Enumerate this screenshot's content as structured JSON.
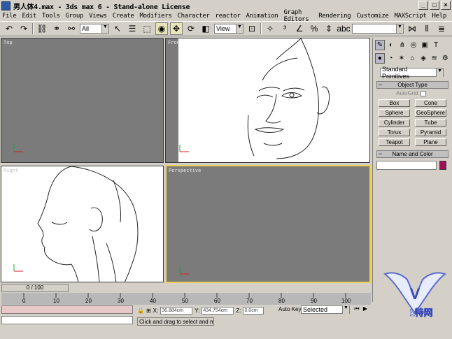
{
  "window": {
    "title": "男人体4.max - 3ds max 6 - Stand-alone License",
    "btn_min": "_",
    "btn_max": "□",
    "btn_close": "×"
  },
  "menu": [
    "File",
    "Edit",
    "Tools",
    "Group",
    "Views",
    "Create",
    "Modifiers",
    "Character",
    "reactor",
    "Animation",
    "Graph Editors",
    "Rendering",
    "Customize",
    "MAXScript",
    "Help"
  ],
  "toolbar": {
    "selection_filter": "All",
    "reference_coord": "View"
  },
  "viewports": {
    "top": "Top",
    "front": "Front",
    "left": "Right",
    "perspective": "Perspective"
  },
  "command_panel": {
    "category_select": "Standard Primitives",
    "object_type_header": "Object Type",
    "autogrid_label": "AutoGrid",
    "primitives": [
      "Box",
      "Cone",
      "Sphere",
      "GeoSphere",
      "Cylinder",
      "Tube",
      "Torus",
      "Pyramid",
      "Teapot",
      "Plane"
    ],
    "name_color_header": "Name and Color",
    "object_color": "#a0105a"
  },
  "timeline": {
    "slider_label": "0 / 100",
    "ticks": [
      "0",
      "10",
      "20",
      "30",
      "40",
      "50",
      "60",
      "70",
      "80",
      "90",
      "100"
    ]
  },
  "status": {
    "x_label": "X:",
    "x_value": "36.884cm",
    "y_label": "Y:",
    "y_value": "434.754cm",
    "z_label": "Z:",
    "z_value": "0.0cm",
    "auto_key": "Auto Key",
    "key_mode": "Selected",
    "prompt": "Click and drag to select and move"
  },
  "watermark": {
    "text": "k特网"
  }
}
